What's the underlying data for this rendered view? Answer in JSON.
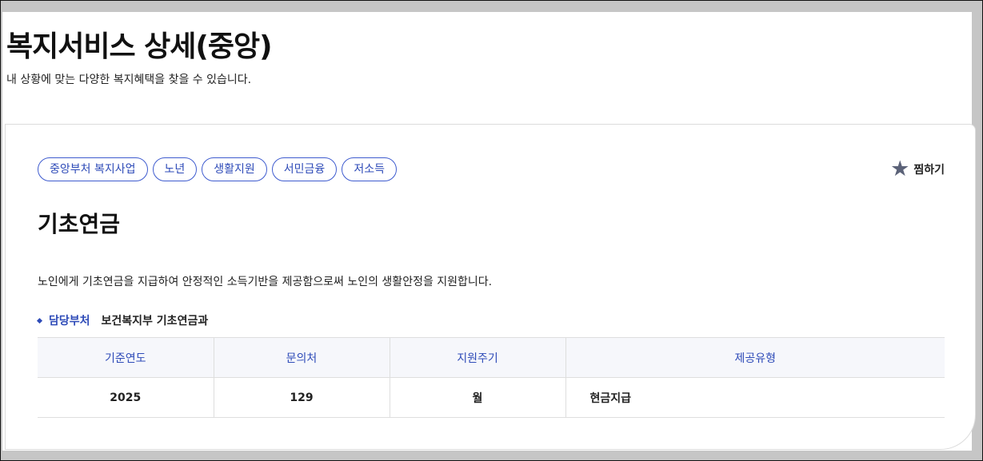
{
  "page": {
    "title": "복지서비스 상세(중앙)",
    "subtitle": "내 상황에 맞는 다양한 복지혜택을 찾을 수 있습니다."
  },
  "tags": [
    "중앙부처 복지사업",
    "노년",
    "생활지원",
    "서민금융",
    "저소득"
  ],
  "favorite": {
    "label": "찜하기",
    "icon": "star-icon",
    "icon_color": "#5b6278"
  },
  "service": {
    "title": "기초연금",
    "description": "노인에게 기초연금을 지급하여 안정적인 소득기반을 제공함으로써 노인의 생활안정을 지원합니다.",
    "department_label": "담당부처",
    "department_value": "보건복지부 기초연금과"
  },
  "table": {
    "headers": [
      "기준연도",
      "문의처",
      "지원주기",
      "제공유형"
    ],
    "row": [
      "2025",
      "129",
      "월",
      "현금지급"
    ]
  },
  "colors": {
    "accent": "#2e4bb8",
    "table_header_bg": "#f6f7fb"
  }
}
